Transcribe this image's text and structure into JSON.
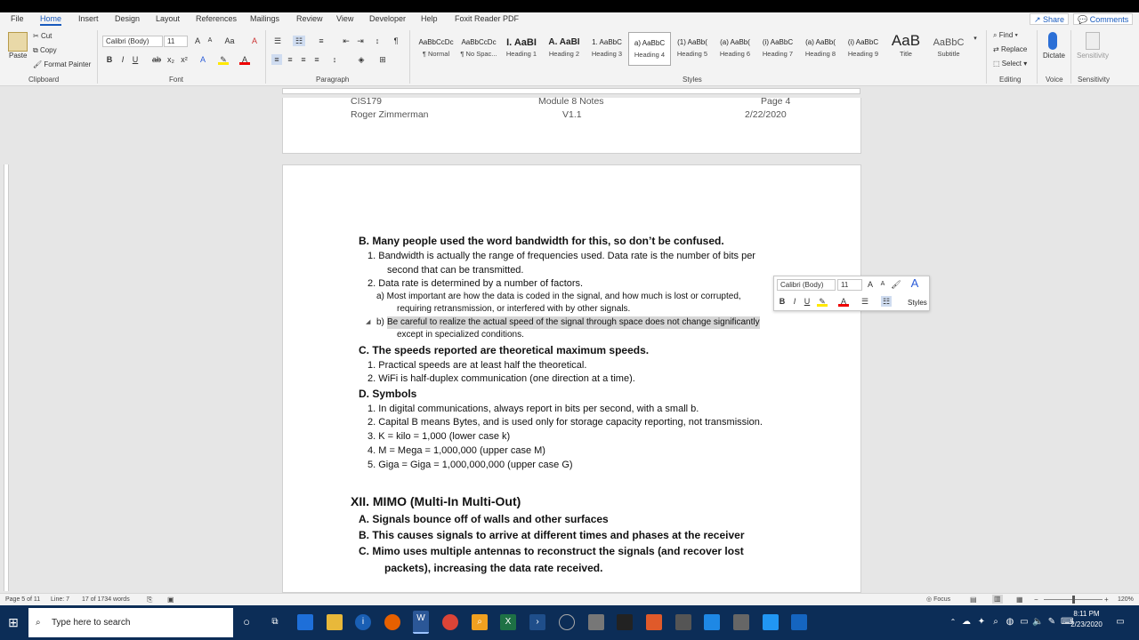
{
  "tabs": [
    "File",
    "Home",
    "Insert",
    "Design",
    "Layout",
    "References",
    "Mailings",
    "Review",
    "View",
    "Developer",
    "Help",
    "Foxit Reader PDF"
  ],
  "share_label": "Share",
  "comments_label": "Comments",
  "clipboard": {
    "paste": "Paste",
    "cut": "Cut",
    "copy": "Copy",
    "format_painter": "Format Painter",
    "label": "Clipboard"
  },
  "font": {
    "name": "Calibri (Body)",
    "size": "11",
    "label": "Font",
    "bold": "B",
    "italic": "I",
    "underline": "U",
    "strike": "ab",
    "sub": "x₂",
    "sup": "x²",
    "color": "A"
  },
  "paragraph_label": "Paragraph",
  "styles": {
    "label": "Styles",
    "items": [
      {
        "sample": "AaBbCcDc",
        "name": "¶ Normal"
      },
      {
        "sample": "AaBbCcDc",
        "name": "¶ No Spac..."
      },
      {
        "sample": "I. AaBI",
        "name": "Heading 1"
      },
      {
        "sample": "A. AaBI",
        "name": "Heading 2"
      },
      {
        "sample": "1. AaBbC",
        "name": "Heading 3"
      },
      {
        "sample": "a) AaBbC",
        "name": "Heading 4"
      },
      {
        "sample": "(1) AaBb(",
        "name": "Heading 5"
      },
      {
        "sample": "(a) AaBb(",
        "name": "Heading 6"
      },
      {
        "sample": "(i) AaBbC",
        "name": "Heading 7"
      },
      {
        "sample": "(a) AaBb(",
        "name": "Heading 8"
      },
      {
        "sample": "(i) AaBbC",
        "name": "Heading 9"
      },
      {
        "sample": "AaB",
        "name": "Title"
      },
      {
        "sample": "AaBbC",
        "name": "Subtitle"
      }
    ]
  },
  "editing": {
    "find": "Find",
    "replace": "Replace",
    "select": "Select",
    "label": "Editing"
  },
  "voice": {
    "dictate": "Dictate",
    "label": "Voice"
  },
  "sensitivity": {
    "button": "Sensitivity",
    "label": "Sensitivity"
  },
  "header": {
    "course": "CIS179",
    "author": "Roger Zimmerman",
    "title": "Module 8 Notes",
    "version": "V1.1",
    "page": "Page 4",
    "date": "2/22/2020"
  },
  "doc": {
    "b_heading": "B. Many people used the word bandwidth for this, so don’t be confused.",
    "b1a": "1. Bandwidth is actually the range of frequencies used. Data rate is the number of bits per",
    "b1b": "second that can be transmitted.",
    "b2": "2. Data rate is determined by a number of factors.",
    "b2a1": "a) Most important are how the data is coded in the signal, and how much is lost or corrupted,",
    "b2a2": "requiring retransmission, or interfered with by other signals.",
    "b2b_marker": "b)",
    "b2b1": "Be careful to realize the actual speed of the signal through space does not change significantly",
    "b2b2": "except in specialized conditions.",
    "c_heading": "C. The speeds reported are theoretical maximum speeds.",
    "c1": "1. Practical speeds are at least half the theoretical.",
    "c2": "2. WiFi is half-duplex communication (one direction at a time).",
    "d_heading": "D. Symbols",
    "d1": "1. In digital communications, always report in bits per second, with a small b.",
    "d2": "2. Capital B means Bytes, and is used only for storage capacity reporting, not transmission.",
    "d3": "3.  K = kilo = 1,000 (lower case k)",
    "d4": "4. M = Mega = 1,000,000 (upper case M)",
    "d5": "5. Giga = Giga = 1,000,000,000 (upper case G)",
    "xii_heading": "XII. MIMO (Multi-In Multi-Out)",
    "xa": "A. Signals bounce off of walls and other surfaces",
    "xb": "B. This causes signals to arrive at different times and phases at the receiver",
    "xc1": "C. Mimo uses multiple antennas to reconstruct the signals (and recover lost",
    "xc2": "packets), increasing the data rate received."
  },
  "minitoolbar": {
    "font": "Calibri (Body)",
    "size": "11",
    "styles": "Styles"
  },
  "status": {
    "page": "Page 5 of 11",
    "line": "Line: 7",
    "words": "17 of 1734 words",
    "focus": "Focus",
    "zoom": "120%"
  },
  "taskbar": {
    "search_placeholder": "Type here to search",
    "time": "8:11 PM",
    "date": "2/23/2020"
  }
}
